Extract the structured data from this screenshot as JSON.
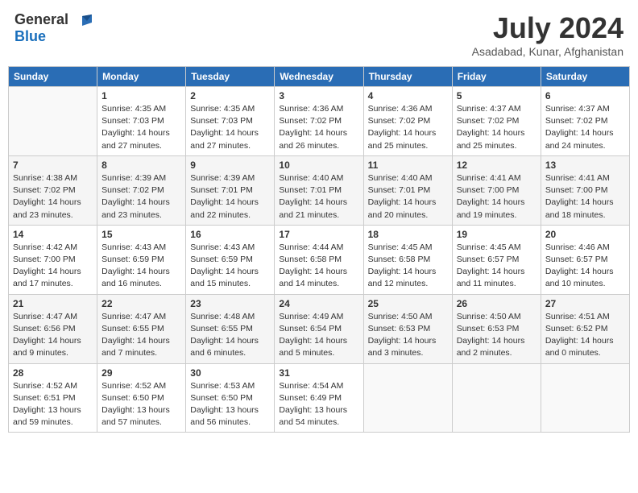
{
  "header": {
    "logo_general": "General",
    "logo_blue": "Blue",
    "month_year": "July 2024",
    "location": "Asadabad, Kunar, Afghanistan"
  },
  "columns": [
    "Sunday",
    "Monday",
    "Tuesday",
    "Wednesday",
    "Thursday",
    "Friday",
    "Saturday"
  ],
  "weeks": [
    [
      {
        "day": "",
        "info": ""
      },
      {
        "day": "1",
        "info": "Sunrise: 4:35 AM\nSunset: 7:03 PM\nDaylight: 14 hours\nand 27 minutes."
      },
      {
        "day": "2",
        "info": "Sunrise: 4:35 AM\nSunset: 7:03 PM\nDaylight: 14 hours\nand 27 minutes."
      },
      {
        "day": "3",
        "info": "Sunrise: 4:36 AM\nSunset: 7:02 PM\nDaylight: 14 hours\nand 26 minutes."
      },
      {
        "day": "4",
        "info": "Sunrise: 4:36 AM\nSunset: 7:02 PM\nDaylight: 14 hours\nand 25 minutes."
      },
      {
        "day": "5",
        "info": "Sunrise: 4:37 AM\nSunset: 7:02 PM\nDaylight: 14 hours\nand 25 minutes."
      },
      {
        "day": "6",
        "info": "Sunrise: 4:37 AM\nSunset: 7:02 PM\nDaylight: 14 hours\nand 24 minutes."
      }
    ],
    [
      {
        "day": "7",
        "info": "Sunrise: 4:38 AM\nSunset: 7:02 PM\nDaylight: 14 hours\nand 23 minutes."
      },
      {
        "day": "8",
        "info": "Sunrise: 4:39 AM\nSunset: 7:02 PM\nDaylight: 14 hours\nand 23 minutes."
      },
      {
        "day": "9",
        "info": "Sunrise: 4:39 AM\nSunset: 7:01 PM\nDaylight: 14 hours\nand 22 minutes."
      },
      {
        "day": "10",
        "info": "Sunrise: 4:40 AM\nSunset: 7:01 PM\nDaylight: 14 hours\nand 21 minutes."
      },
      {
        "day": "11",
        "info": "Sunrise: 4:40 AM\nSunset: 7:01 PM\nDaylight: 14 hours\nand 20 minutes."
      },
      {
        "day": "12",
        "info": "Sunrise: 4:41 AM\nSunset: 7:00 PM\nDaylight: 14 hours\nand 19 minutes."
      },
      {
        "day": "13",
        "info": "Sunrise: 4:41 AM\nSunset: 7:00 PM\nDaylight: 14 hours\nand 18 minutes."
      }
    ],
    [
      {
        "day": "14",
        "info": "Sunrise: 4:42 AM\nSunset: 7:00 PM\nDaylight: 14 hours\nand 17 minutes."
      },
      {
        "day": "15",
        "info": "Sunrise: 4:43 AM\nSunset: 6:59 PM\nDaylight: 14 hours\nand 16 minutes."
      },
      {
        "day": "16",
        "info": "Sunrise: 4:43 AM\nSunset: 6:59 PM\nDaylight: 14 hours\nand 15 minutes."
      },
      {
        "day": "17",
        "info": "Sunrise: 4:44 AM\nSunset: 6:58 PM\nDaylight: 14 hours\nand 14 minutes."
      },
      {
        "day": "18",
        "info": "Sunrise: 4:45 AM\nSunset: 6:58 PM\nDaylight: 14 hours\nand 12 minutes."
      },
      {
        "day": "19",
        "info": "Sunrise: 4:45 AM\nSunset: 6:57 PM\nDaylight: 14 hours\nand 11 minutes."
      },
      {
        "day": "20",
        "info": "Sunrise: 4:46 AM\nSunset: 6:57 PM\nDaylight: 14 hours\nand 10 minutes."
      }
    ],
    [
      {
        "day": "21",
        "info": "Sunrise: 4:47 AM\nSunset: 6:56 PM\nDaylight: 14 hours\nand 9 minutes."
      },
      {
        "day": "22",
        "info": "Sunrise: 4:47 AM\nSunset: 6:55 PM\nDaylight: 14 hours\nand 7 minutes."
      },
      {
        "day": "23",
        "info": "Sunrise: 4:48 AM\nSunset: 6:55 PM\nDaylight: 14 hours\nand 6 minutes."
      },
      {
        "day": "24",
        "info": "Sunrise: 4:49 AM\nSunset: 6:54 PM\nDaylight: 14 hours\nand 5 minutes."
      },
      {
        "day": "25",
        "info": "Sunrise: 4:50 AM\nSunset: 6:53 PM\nDaylight: 14 hours\nand 3 minutes."
      },
      {
        "day": "26",
        "info": "Sunrise: 4:50 AM\nSunset: 6:53 PM\nDaylight: 14 hours\nand 2 minutes."
      },
      {
        "day": "27",
        "info": "Sunrise: 4:51 AM\nSunset: 6:52 PM\nDaylight: 14 hours\nand 0 minutes."
      }
    ],
    [
      {
        "day": "28",
        "info": "Sunrise: 4:52 AM\nSunset: 6:51 PM\nDaylight: 13 hours\nand 59 minutes."
      },
      {
        "day": "29",
        "info": "Sunrise: 4:52 AM\nSunset: 6:50 PM\nDaylight: 13 hours\nand 57 minutes."
      },
      {
        "day": "30",
        "info": "Sunrise: 4:53 AM\nSunset: 6:50 PM\nDaylight: 13 hours\nand 56 minutes."
      },
      {
        "day": "31",
        "info": "Sunrise: 4:54 AM\nSunset: 6:49 PM\nDaylight: 13 hours\nand 54 minutes."
      },
      {
        "day": "",
        "info": ""
      },
      {
        "day": "",
        "info": ""
      },
      {
        "day": "",
        "info": ""
      }
    ]
  ]
}
